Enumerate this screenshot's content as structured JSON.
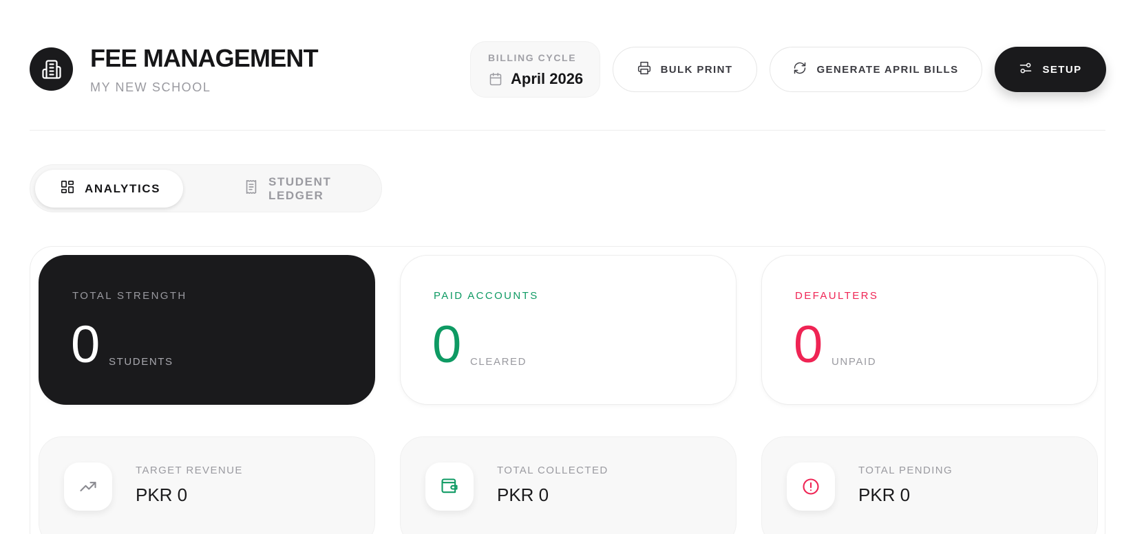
{
  "header": {
    "title": "FEE MANAGEMENT",
    "subtitle": "MY NEW SCHOOL",
    "logo_icon": "building-icon"
  },
  "billing": {
    "label": "BILLING CYCLE",
    "value": "April 2026",
    "icon": "calendar-icon"
  },
  "actions": {
    "bulk_print": "BULK PRINT",
    "generate": "GENERATE APRIL BILLS",
    "setup": "SETUP"
  },
  "tabs": [
    {
      "label": "ANALYTICS",
      "icon": "dashboard-icon",
      "active": true
    },
    {
      "label": "STUDENT LEDGER",
      "icon": "receipt-icon",
      "active": false
    }
  ],
  "stats": [
    {
      "label": "TOTAL STRENGTH",
      "value": "0",
      "unit": "STUDENTS"
    },
    {
      "label": "PAID ACCOUNTS",
      "value": "0",
      "unit": "CLEARED"
    },
    {
      "label": "DEFAULTERS",
      "value": "0",
      "unit": "UNPAID"
    }
  ],
  "money": [
    {
      "label": "TARGET REVENUE",
      "value": "PKR 0",
      "icon": "trending-up-icon"
    },
    {
      "label": "TOTAL COLLECTED",
      "value": "PKR 0",
      "icon": "wallet-icon"
    },
    {
      "label": "TOTAL PENDING",
      "value": "PKR 0",
      "icon": "alert-circle-icon"
    }
  ],
  "colors": {
    "dark": "#1a1a1c",
    "paid": "#0e9a63",
    "defaulters": "#ef2454",
    "muted": "#9a9aa0"
  }
}
